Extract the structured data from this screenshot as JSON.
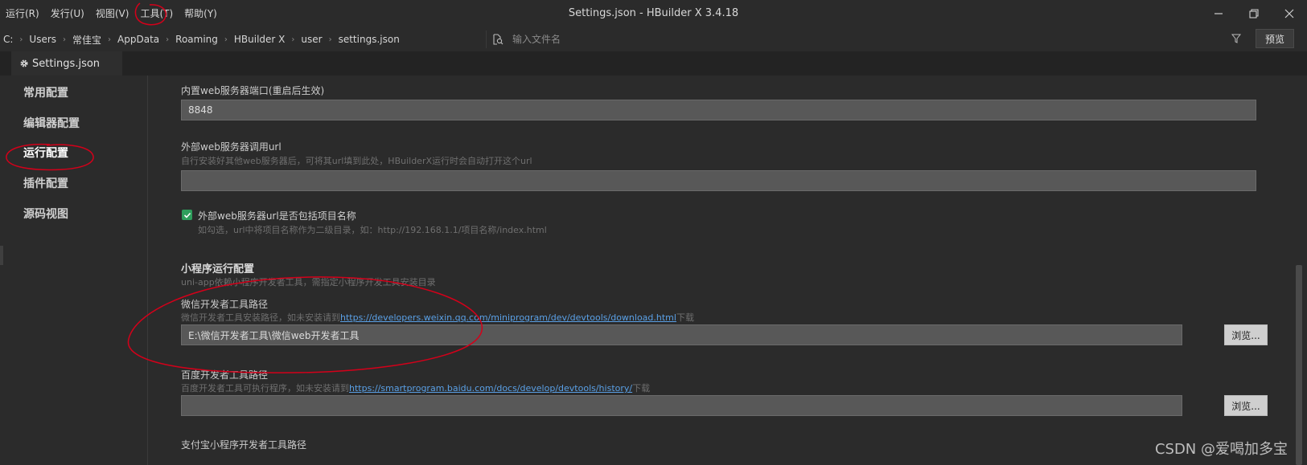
{
  "menu": [
    "运行(R)",
    "发行(U)",
    "视图(V)",
    "工具(T)",
    "帮助(Y)"
  ],
  "window": {
    "title": "Settings.json - HBuilder X 3.4.18"
  },
  "breadcrumb": [
    "C:",
    "Users",
    "常佳宝",
    "AppData",
    "Roaming",
    "HBuilder X",
    "user",
    "settings.json"
  ],
  "search": {
    "placeholder": "输入文件名"
  },
  "toolbar": {
    "preview_label": "预览"
  },
  "tab": {
    "label": "Settings.json"
  },
  "sidebar": {
    "items": [
      "常用配置",
      "编辑器配置",
      "运行配置",
      "插件配置",
      "源码视图"
    ],
    "active_index": 2
  },
  "content": {
    "port": {
      "label": "内置web服务器端口(重启后生效)",
      "value": "8848"
    },
    "external_url": {
      "label": "外部web服务器调用url",
      "hint": "自行安装好其他web服务器后，可将其url填到此处，HBuilderX运行时会自动打开这个url",
      "value": ""
    },
    "include_project": {
      "label": "外部web服务器url是否包括项目名称",
      "hint": "如勾选，url中将项目名称作为二级目录，如：http://192.168.1.1/项目名称/index.html",
      "checked": true
    },
    "miniprogram": {
      "title": "小程序运行配置",
      "hint": "uni-app依赖小程序开发者工具，需指定小程序开发工具安装目录"
    },
    "wechat": {
      "label": "微信开发者工具路径",
      "hint_prefix": "微信开发者工具安装路径，如未安装请到",
      "link": "https://developers.weixin.qq.com/miniprogram/dev/devtools/download.html",
      "hint_suffix": "下载",
      "value": "E:\\微信开发者工具\\微信web开发者工具",
      "browse_label": "浏览..."
    },
    "baidu": {
      "label": "百度开发者工具路径",
      "hint_prefix": "百度开发者工具可执行程序，如未安装请到",
      "link": "https://smartprogram.baidu.com/docs/develop/devtools/history/",
      "hint_suffix": "下载",
      "value": "",
      "browse_label": "浏览..."
    },
    "alipay": {
      "label": "支付宝小程序开发者工具路径"
    }
  },
  "watermark": "CSDN @爱喝加多宝",
  "colors": {
    "background": "#2b2b2b",
    "field": "#585858",
    "checkbox": "#2e9e5c",
    "link": "#5aa0e6",
    "annotation": "#d4001a"
  }
}
